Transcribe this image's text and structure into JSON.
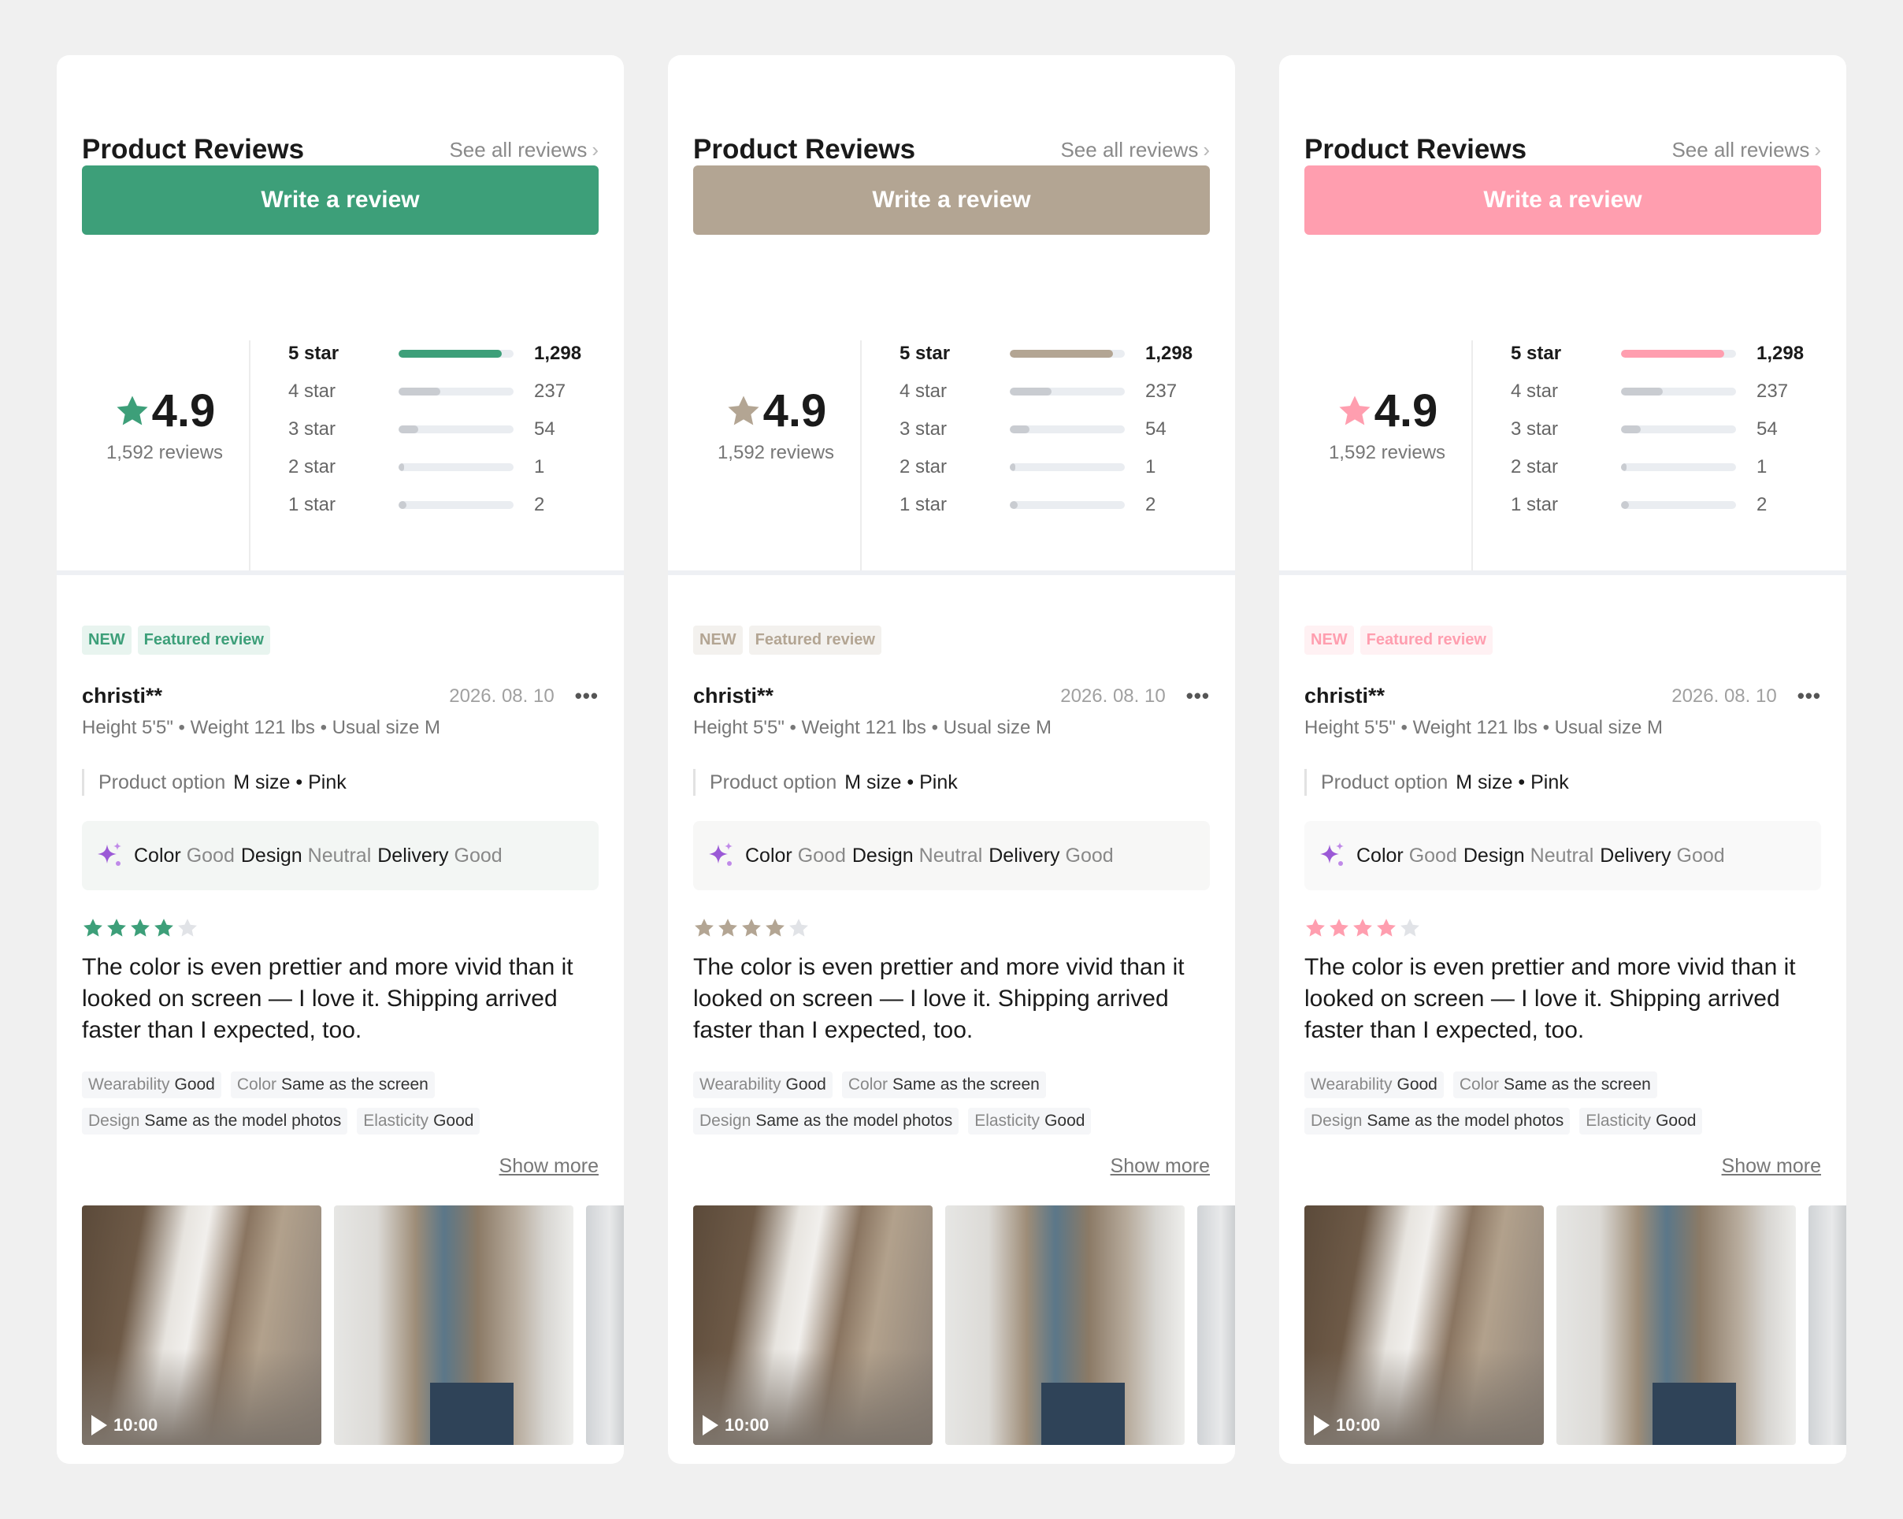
{
  "cards": [
    {
      "accent": "#3d9f79",
      "badge_bg": "#e8f4ef",
      "ai_bg": "#f3f6f4"
    },
    {
      "accent": "#b3a593",
      "badge_bg": "#f3f1ee",
      "ai_bg": "#f7f7f6"
    },
    {
      "accent": "#ff9eaf",
      "badge_bg": "#fff1f3",
      "ai_bg": "#f9f9f9"
    }
  ],
  "header": {
    "title": "Product Reviews",
    "see_all": "See all reviews"
  },
  "write_button": "Write a review",
  "summary": {
    "score": "4.9",
    "count_text": "1,592 reviews"
  },
  "distribution": [
    {
      "label": "5 star",
      "count": "1,298",
      "fill": 0.9
    },
    {
      "label": "4 star",
      "count": "237",
      "fill": 0.36
    },
    {
      "label": "3 star",
      "count": "54",
      "fill": 0.17
    },
    {
      "label": "2 star",
      "count": "1",
      "fill": 0.05
    },
    {
      "label": "1 star",
      "count": "2",
      "fill": 0.07
    }
  ],
  "badges": {
    "new": "NEW",
    "featured": "Featured review"
  },
  "review": {
    "user": "christi**",
    "date": "2026. 08. 10",
    "more": "•••",
    "body_info": "Height 5'5\" • Weight 121 lbs • Usual size M",
    "option_label": "Product option",
    "option_value": "M size • Pink",
    "ai": [
      {
        "key": "Color",
        "value": "Good"
      },
      {
        "key": "Design",
        "value": "Neutral"
      },
      {
        "key": "Delivery",
        "value": "Good"
      }
    ],
    "rating": 4,
    "text": "The color is even prettier and more vivid than it looked on screen — I love it. Shipping arrived faster than I expected, too.",
    "tags": [
      {
        "key": "Wearability",
        "value": "Good"
      },
      {
        "key": "Color",
        "value": "Same as the screen"
      },
      {
        "key": "Design",
        "value": "Same as the model photos"
      },
      {
        "key": "Elasticity",
        "value": "Good"
      }
    ],
    "show_more": "Show more",
    "video_duration": "10:00"
  },
  "icons": {
    "star": "star-icon",
    "sparkle": "ai-sparkle-icon",
    "chevron": "chevron-right-icon",
    "play": "play-icon"
  }
}
